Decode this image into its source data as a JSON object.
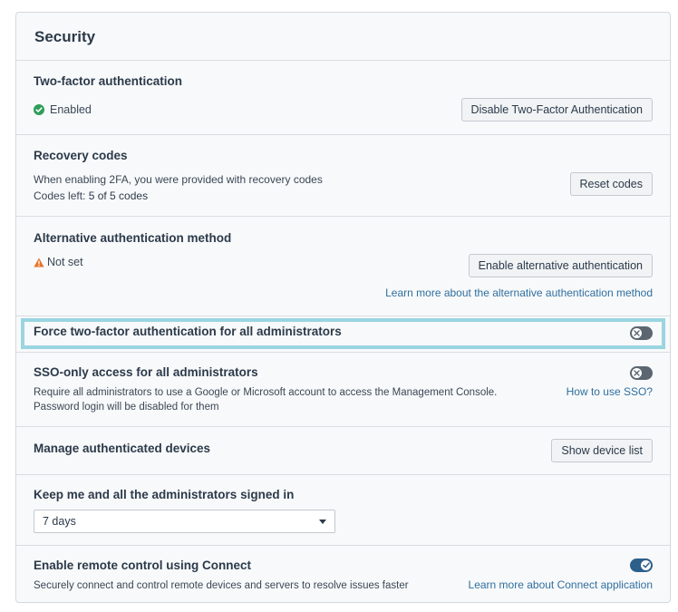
{
  "panel": {
    "title": "Security"
  },
  "two_factor": {
    "title": "Two-factor authentication",
    "status": "Enabled",
    "button": "Disable Two-Factor Authentication"
  },
  "recovery": {
    "title": "Recovery codes",
    "description": "When enabling 2FA, you were provided with recovery codes",
    "codes_prefix": "Codes left: ",
    "codes_value": "5 of 5 codes",
    "button": "Reset codes"
  },
  "alternative": {
    "title": "Alternative authentication method",
    "status": "Not set",
    "button": "Enable alternative authentication",
    "link": "Learn more about the alternative authentication method"
  },
  "force_2fa": {
    "title": "Force two-factor authentication for all administrators",
    "enabled": false
  },
  "sso": {
    "title": "SSO-only access for all administrators",
    "line1": "Require all administrators to use a Google or Microsoft account to access the Management Console.",
    "line2": "Password login will be disabled for them",
    "link": "How to use SSO?",
    "enabled": false
  },
  "devices": {
    "title": "Manage authenticated devices",
    "button": "Show device list"
  },
  "keep_signed": {
    "title": "Keep me and all the administrators signed in",
    "selected": "7 days"
  },
  "remote": {
    "title": "Enable remote control using Connect",
    "description": "Securely connect and control remote devices and servers to resolve issues faster",
    "link": "Learn more about Connect application",
    "enabled": true
  },
  "colors": {
    "success": "#2e9e5b",
    "warning": "#e8742a",
    "link": "#2f6f9f",
    "highlight": "#9ad5e1",
    "toggle_on": "#2c5f8a",
    "toggle_off": "#5c6670"
  },
  "icons": {
    "enabled_status": "check-circle-icon",
    "not_set_status": "warning-triangle-icon",
    "toggle_off": "x-icon",
    "toggle_on": "check-icon",
    "dropdown": "caret-down-icon"
  }
}
